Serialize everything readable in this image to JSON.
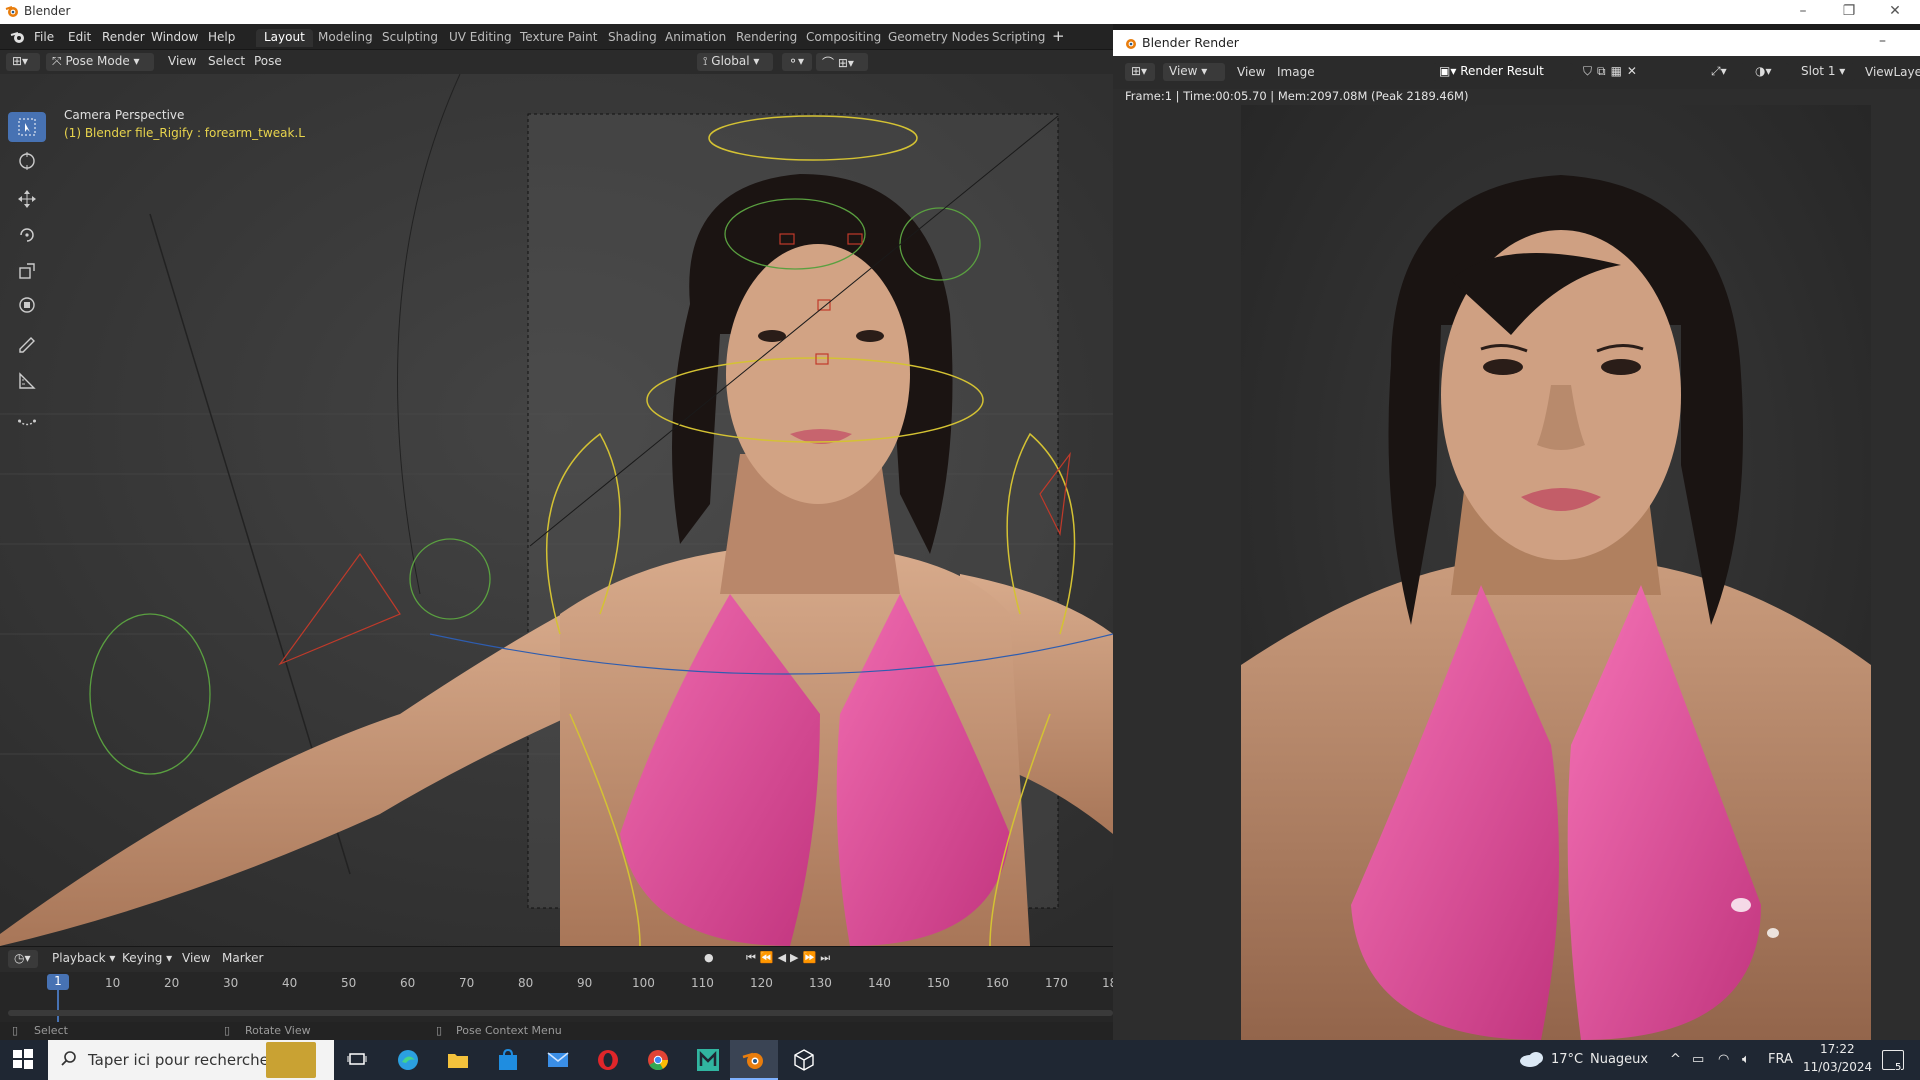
{
  "window": {
    "title": "Blender"
  },
  "menubar": {
    "file": "File",
    "edit": "Edit",
    "render": "Render",
    "window": "Window",
    "help": "Help"
  },
  "workspaces": [
    "Layout",
    "Modeling",
    "Sculpting",
    "UV Editing",
    "Texture Paint",
    "Shading",
    "Animation",
    "Rendering",
    "Compositing",
    "Geometry Nodes",
    "Scripting"
  ],
  "viewport_header": {
    "mode": "Pose Mode",
    "view": "View",
    "select": "Select",
    "pose": "Pose",
    "transform_orientation": "Global"
  },
  "viewport": {
    "camera_label": "Camera Perspective",
    "object_label": "(1) Blender file_Rigify : forearm_tweak.L"
  },
  "timeline": {
    "playback": "Playback",
    "keying": "Keying",
    "view": "View",
    "marker": "Marker",
    "current_frame": "1",
    "frames": [
      "10",
      "20",
      "30",
      "40",
      "50",
      "60",
      "70",
      "80",
      "90",
      "100",
      "110",
      "120",
      "130",
      "140",
      "150",
      "160",
      "170",
      "18"
    ]
  },
  "statusbar": {
    "select": "Select",
    "rotate": "Rotate View",
    "context": "Pose Context Menu"
  },
  "render_window": {
    "title": "Blender Render",
    "view1": "View",
    "view2": "View",
    "image": "Image",
    "result": "Render Result",
    "slot": "Slot 1",
    "view_layer": "ViewLayer",
    "info": "Frame:1 | Time:00:05.70 | Mem:2097.08M (Peak 2189.46M)"
  },
  "taskbar": {
    "search_placeholder": "Taper ici pour rechercher",
    "weather_temp": "17°C",
    "weather_desc": "Nuageux",
    "language": "FRA",
    "time": "17:22",
    "date": "11/03/2024",
    "notification_count": "5"
  },
  "colors": {
    "accent_blue": "#4772b3",
    "pose_yellow": "#e8d44d",
    "bikini_pink": "#e04f9a",
    "skin": "#c89878"
  }
}
